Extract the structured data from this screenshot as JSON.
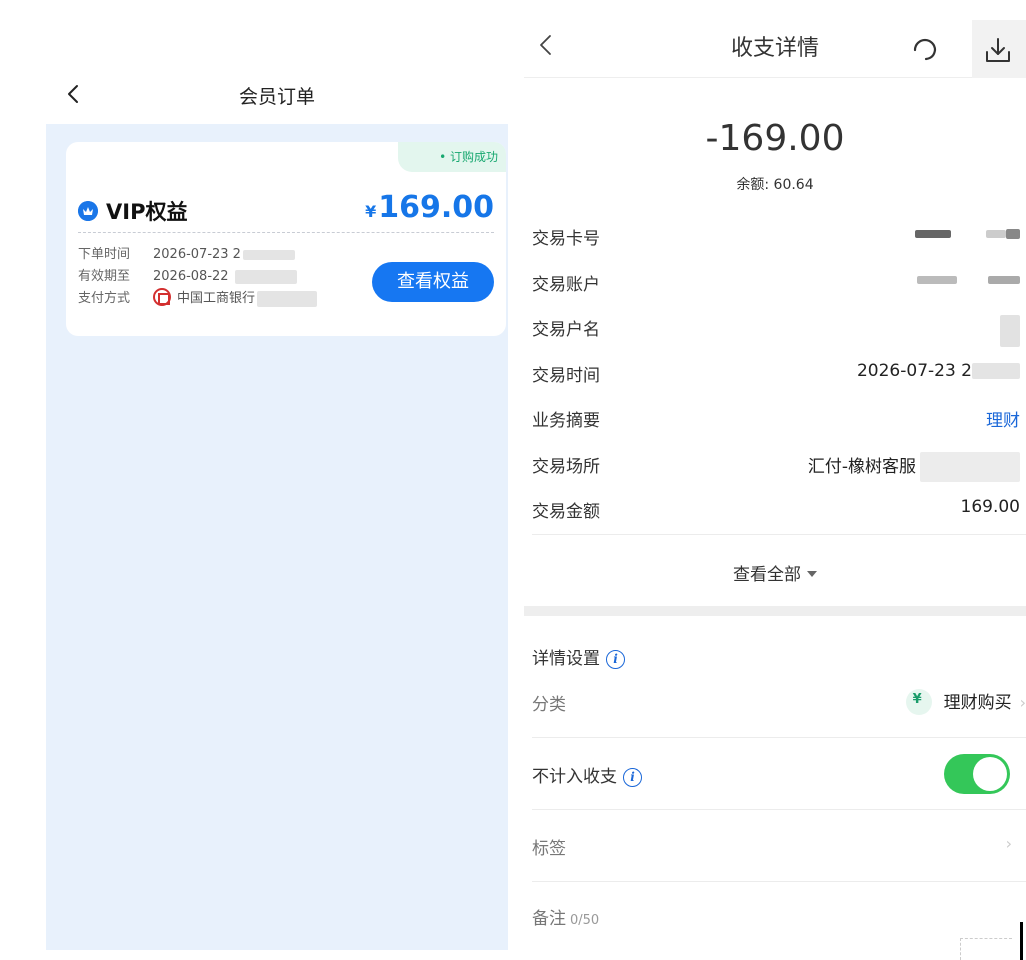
{
  "left_screen": {
    "nav_title": "会员订单",
    "order": {
      "status": "• 订购成功",
      "product_name": "VIP权益",
      "currency_symbol": "¥",
      "price": "169.00",
      "order_time_label": "下单时间",
      "order_time_value": "2026-07-23 2",
      "valid_until_label": "有效期至",
      "valid_until_value": "2026-08-22",
      "payment_label": "支付方式",
      "payment_value": "中国工商银行",
      "view_button": "查看权益"
    }
  },
  "right_screen": {
    "nav_title": "收支详情",
    "amount": "-169.00",
    "balance": "余额: 60.64",
    "details": [
      {
        "label": "交易卡号",
        "value": ""
      },
      {
        "label": "交易账户",
        "value": ""
      },
      {
        "label": "交易户名",
        "value": ""
      },
      {
        "label": "交易时间",
        "value": "2026-07-23 2"
      },
      {
        "label": "业务摘要",
        "value": "理财"
      },
      {
        "label": "交易场所",
        "value": "汇付-橡树客服"
      },
      {
        "label": "交易金额",
        "value": "169.00"
      }
    ],
    "view_all": "查看全部",
    "settings_title": "详情设置",
    "category_label": "分类",
    "category_value": "理财购买",
    "exclude_label": "不计入收支",
    "exclude_toggle_on": true,
    "tag_label": "标签",
    "note_label": "备注",
    "note_count": "0/50",
    "colors": {
      "accent_blue": "#1677f2",
      "toggle_green": "#34c759",
      "status_green": "#18a870"
    }
  }
}
